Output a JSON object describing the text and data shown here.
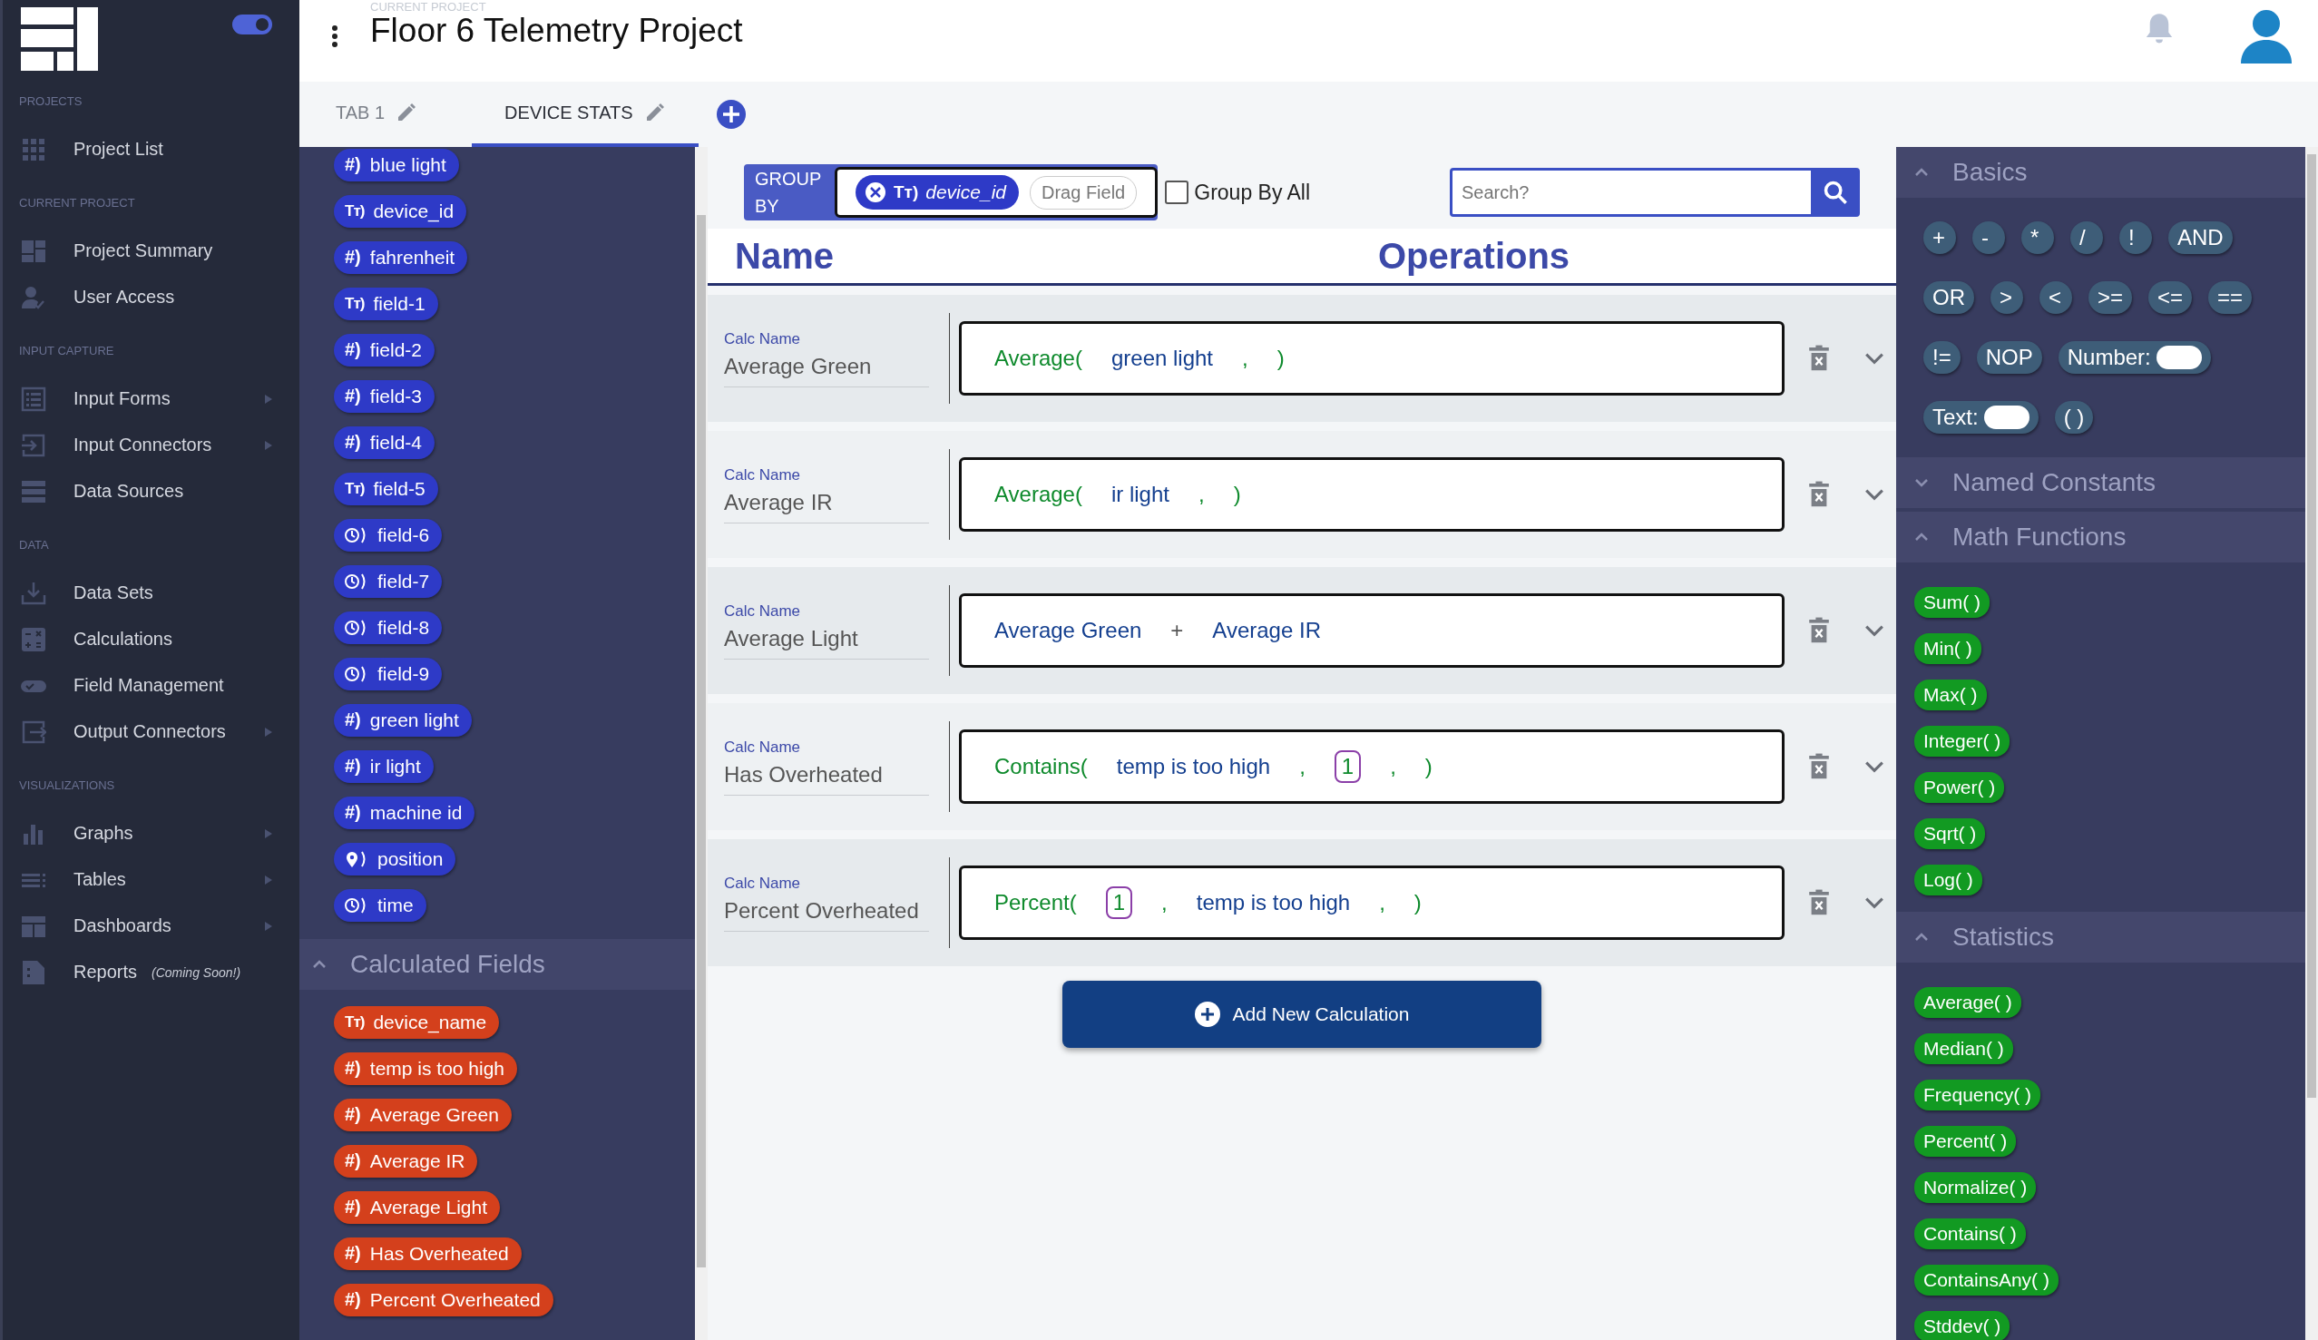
{
  "sidebar": {
    "theme_toggle_on": true,
    "sections": [
      {
        "heading": "PROJECTS",
        "items": [
          {
            "label": "Project List",
            "submenu": false
          }
        ]
      },
      {
        "heading": "CURRENT PROJECT",
        "items": [
          {
            "label": "Project Summary",
            "submenu": false
          },
          {
            "label": "User Access",
            "submenu": false
          }
        ]
      },
      {
        "heading": "INPUT CAPTURE",
        "items": [
          {
            "label": "Input Forms",
            "submenu": true
          },
          {
            "label": "Input Connectors",
            "submenu": true
          },
          {
            "label": "Data Sources",
            "submenu": false
          }
        ]
      },
      {
        "heading": "DATA",
        "items": [
          {
            "label": "Data Sets",
            "submenu": false
          },
          {
            "label": "Calculations",
            "submenu": false
          },
          {
            "label": "Field Management",
            "submenu": false
          },
          {
            "label": "Output Connectors",
            "submenu": true
          }
        ]
      },
      {
        "heading": "VISUALIZATIONS",
        "items": [
          {
            "label": "Graphs",
            "submenu": true
          },
          {
            "label": "Tables",
            "submenu": true
          },
          {
            "label": "Dashboards",
            "submenu": true
          },
          {
            "label": "Reports",
            "submenu": false,
            "note": "(Coming Soon!)"
          }
        ]
      }
    ]
  },
  "header": {
    "caption": "CURRENT PROJECT",
    "title": "Floor 6 Telemetry Project"
  },
  "tabs": [
    {
      "label": "TAB 1",
      "selected": false
    },
    {
      "label": "DEVICE STATS",
      "selected": true
    }
  ],
  "fields": [
    {
      "label": "blue light",
      "kind": "number",
      "glyph": "#)"
    },
    {
      "label": "device_id",
      "kind": "text",
      "glyph": "Tт)"
    },
    {
      "label": "fahrenheit",
      "kind": "number",
      "glyph": "#)"
    },
    {
      "label": "field-1",
      "kind": "text",
      "glyph": "Tт)"
    },
    {
      "label": "field-2",
      "kind": "number",
      "glyph": "#)"
    },
    {
      "label": "field-3",
      "kind": "number",
      "glyph": "#)"
    },
    {
      "label": "field-4",
      "kind": "number",
      "glyph": "#)"
    },
    {
      "label": "field-5",
      "kind": "text",
      "glyph": "Tт)"
    },
    {
      "label": "field-6",
      "kind": "time"
    },
    {
      "label": "field-7",
      "kind": "time"
    },
    {
      "label": "field-8",
      "kind": "time"
    },
    {
      "label": "field-9",
      "kind": "time"
    },
    {
      "label": "green light",
      "kind": "number",
      "glyph": "#)"
    },
    {
      "label": "ir light",
      "kind": "number",
      "glyph": "#)"
    },
    {
      "label": "machine id",
      "kind": "number",
      "glyph": "#)"
    },
    {
      "label": "position",
      "kind": "location"
    },
    {
      "label": "time",
      "kind": "time"
    }
  ],
  "calculated_fields": {
    "title": "Calculated Fields",
    "expanded": true,
    "items": [
      {
        "label": "device_name",
        "kind": "text",
        "glyph": "Tт)"
      },
      {
        "label": "temp is too high",
        "kind": "number",
        "glyph": "#)"
      },
      {
        "label": "Average Green",
        "kind": "number",
        "glyph": "#)"
      },
      {
        "label": "Average IR",
        "kind": "number",
        "glyph": "#)"
      },
      {
        "label": "Average Light",
        "kind": "number",
        "glyph": "#)"
      },
      {
        "label": "Has Overheated",
        "kind": "number",
        "glyph": "#)"
      },
      {
        "label": "Percent Overheated",
        "kind": "number",
        "glyph": "#)"
      }
    ]
  },
  "group_by": {
    "label": "GROUP BY",
    "chip": {
      "label": "device_id",
      "glyph": "Tт)"
    },
    "drop_hint": "Drag Field",
    "group_by_all": {
      "label": "Group By All",
      "checked": false
    }
  },
  "search": {
    "placeholder": "Search?"
  },
  "columns": [
    "Name",
    "Operations"
  ],
  "calculations": [
    {
      "name_label": "Calc Name",
      "name": "Average Green",
      "tokens": [
        {
          "text": "Average(",
          "kind": "func"
        },
        {
          "text": "green light",
          "kind": "field"
        },
        {
          "text": ",",
          "kind": "punct"
        },
        {
          "text": ")",
          "kind": "punct"
        }
      ]
    },
    {
      "name_label": "Calc Name",
      "name": "Average IR",
      "tokens": [
        {
          "text": "Average(",
          "kind": "func"
        },
        {
          "text": "ir light",
          "kind": "field"
        },
        {
          "text": ",",
          "kind": "punct"
        },
        {
          "text": ")",
          "kind": "punct"
        }
      ]
    },
    {
      "name_label": "Calc Name",
      "name": "Average Light",
      "tokens": [
        {
          "text": "Average Green",
          "kind": "field"
        },
        {
          "text": "+",
          "kind": "op"
        },
        {
          "text": "Average IR",
          "kind": "field"
        }
      ]
    },
    {
      "name_label": "Calc Name",
      "name": "Has Overheated",
      "tokens": [
        {
          "text": "Contains(",
          "kind": "func"
        },
        {
          "text": "temp is too high",
          "kind": "field"
        },
        {
          "text": ",",
          "kind": "punct"
        },
        {
          "text": "1",
          "kind": "number"
        },
        {
          "text": ",",
          "kind": "punct"
        },
        {
          "text": ")",
          "kind": "punct"
        }
      ]
    },
    {
      "name_label": "Calc Name",
      "name": "Percent Overheated",
      "tokens": [
        {
          "text": "Percent(",
          "kind": "func"
        },
        {
          "text": "1",
          "kind": "number"
        },
        {
          "text": ",",
          "kind": "punct"
        },
        {
          "text": "temp is too high",
          "kind": "field"
        },
        {
          "text": ",",
          "kind": "punct"
        },
        {
          "text": ")",
          "kind": "punct"
        }
      ]
    }
  ],
  "add_button": "Add New Calculation",
  "palette": [
    {
      "title": "Basics",
      "expanded": true,
      "items": [
        {
          "label": "+",
          "kind": "op"
        },
        {
          "label": "-",
          "kind": "op"
        },
        {
          "label": "*",
          "kind": "op"
        },
        {
          "label": "/",
          "kind": "op"
        },
        {
          "label": "!",
          "kind": "op"
        },
        {
          "label": "AND",
          "kind": "op"
        },
        {
          "label": "OR",
          "kind": "op"
        },
        {
          "label": ">",
          "kind": "op"
        },
        {
          "label": "<",
          "kind": "op"
        },
        {
          "label": ">=",
          "kind": "op"
        },
        {
          "label": "<=",
          "kind": "op"
        },
        {
          "label": "==",
          "kind": "op"
        },
        {
          "label": "!=",
          "kind": "op"
        },
        {
          "label": "NOP",
          "kind": "op"
        },
        {
          "label": "Number:",
          "kind": "input"
        },
        {
          "label": "Text:",
          "kind": "input"
        },
        {
          "label": "( )",
          "kind": "op"
        }
      ]
    },
    {
      "title": "Named Constants",
      "expanded": false
    },
    {
      "title": "Math Functions",
      "expanded": true,
      "items": [
        {
          "label": "Sum( )",
          "kind": "func"
        },
        {
          "label": "Min( )",
          "kind": "func"
        },
        {
          "label": "Max( )",
          "kind": "func"
        },
        {
          "label": "Integer( )",
          "kind": "func"
        },
        {
          "label": "Power( )",
          "kind": "func"
        },
        {
          "label": "Sqrt( )",
          "kind": "func"
        },
        {
          "label": "Log( )",
          "kind": "func"
        }
      ]
    },
    {
      "title": "Statistics",
      "expanded": true,
      "items": [
        {
          "label": "Average( )",
          "kind": "func"
        },
        {
          "label": "Median( )",
          "kind": "func"
        },
        {
          "label": "Frequency( )",
          "kind": "func"
        },
        {
          "label": "Percent( )",
          "kind": "func"
        },
        {
          "label": "Normalize( )",
          "kind": "func"
        },
        {
          "label": "Contains( )",
          "kind": "func"
        },
        {
          "label": "ContainsAny( )",
          "kind": "func"
        },
        {
          "label": "Stddev( )",
          "kind": "func"
        }
      ]
    }
  ]
}
